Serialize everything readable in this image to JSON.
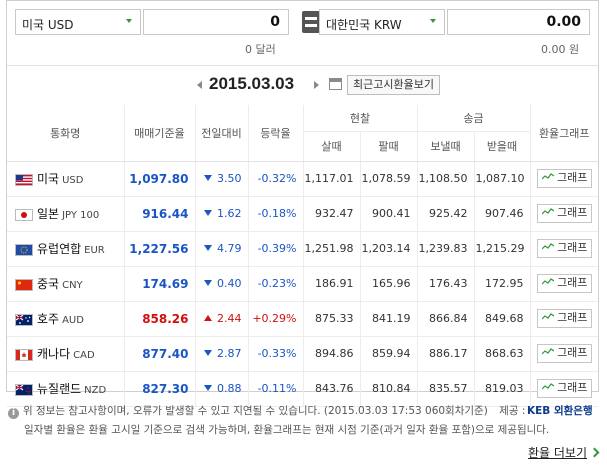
{
  "converter": {
    "from_currency": "미국 USD",
    "from_amount": "0",
    "from_sub": "0 달러",
    "to_currency": "대한민국 KRW",
    "to_amount": "0.00",
    "to_sub": "0.00 원",
    "from_caret_icon": "caret-down-icon",
    "equals_icon": "equals-icon"
  },
  "datebar": {
    "date": "2015.03.03",
    "recent_button": "최근고시환율보기",
    "prev_icon": "arrow-left-icon",
    "next_icon": "arrow-right-icon",
    "calendar_icon": "calendar-icon"
  },
  "table": {
    "headers": {
      "currency": "통화명",
      "base_rate": "매매기준율",
      "change": "전일대비",
      "rate": "등락율",
      "cash": "현찰",
      "cash_buy": "살때",
      "cash_sell": "팔때",
      "remit": "송금",
      "remit_send": "보낼때",
      "remit_receive": "받을때",
      "graph": "환율그래프"
    },
    "graph_button": "그래프",
    "rows": [
      {
        "flag": "us",
        "name": "미국",
        "code": "USD",
        "base": "1,097.80",
        "dir": "down",
        "change": "3.50",
        "rate": "-0.32%",
        "cash_buy": "1,117.01",
        "cash_sell": "1,078.59",
        "remit_send": "1,108.50",
        "remit_receive": "1,087.10"
      },
      {
        "flag": "jp",
        "name": "일본",
        "code": "JPY 100",
        "base": "916.44",
        "dir": "down",
        "change": "1.62",
        "rate": "-0.18%",
        "cash_buy": "932.47",
        "cash_sell": "900.41",
        "remit_send": "925.42",
        "remit_receive": "907.46"
      },
      {
        "flag": "eu",
        "name": "유럽연합",
        "code": "EUR",
        "base": "1,227.56",
        "dir": "down",
        "change": "4.79",
        "rate": "-0.39%",
        "cash_buy": "1,251.98",
        "cash_sell": "1,203.14",
        "remit_send": "1,239.83",
        "remit_receive": "1,215.29"
      },
      {
        "flag": "cn",
        "name": "중국",
        "code": "CNY",
        "base": "174.69",
        "dir": "down",
        "change": "0.40",
        "rate": "-0.23%",
        "cash_buy": "186.91",
        "cash_sell": "165.96",
        "remit_send": "176.43",
        "remit_receive": "172.95"
      },
      {
        "flag": "au",
        "name": "호주",
        "code": "AUD",
        "base": "858.26",
        "dir": "up",
        "change": "2.44",
        "rate": "+0.29%",
        "cash_buy": "875.33",
        "cash_sell": "841.19",
        "remit_send": "866.84",
        "remit_receive": "849.68"
      },
      {
        "flag": "ca",
        "name": "캐나다",
        "code": "CAD",
        "base": "877.40",
        "dir": "down",
        "change": "2.87",
        "rate": "-0.33%",
        "cash_buy": "894.86",
        "cash_sell": "859.94",
        "remit_send": "886.17",
        "remit_receive": "868.63"
      },
      {
        "flag": "nz",
        "name": "뉴질랜드",
        "code": "NZD",
        "base": "827.30",
        "dir": "down",
        "change": "0.88",
        "rate": "-0.11%",
        "cash_buy": "843.76",
        "cash_sell": "810.84",
        "remit_send": "835.57",
        "remit_receive": "819.03"
      }
    ]
  },
  "footer": {
    "notice1": "위 정보는 참고사항이며, 오류가 발생할 수 있고 지연될 수 있습니다. (2015.03.03 17:53 060회차기준)",
    "source_label": "제공 :",
    "bank_name": "KEB 외환은행",
    "notice2": "일자별 환율은 환율 고시일 기준으로 검색 가능하며, 환율그래프는 현재 시점 기준(과거 일자 환율 포함)으로 제공됩니다.",
    "more_link": "환율 더보기",
    "info_icon": "info-icon"
  },
  "colors": {
    "down": "#1a55c4",
    "up": "#d10f0f",
    "accent_green": "#2e9a3a"
  }
}
